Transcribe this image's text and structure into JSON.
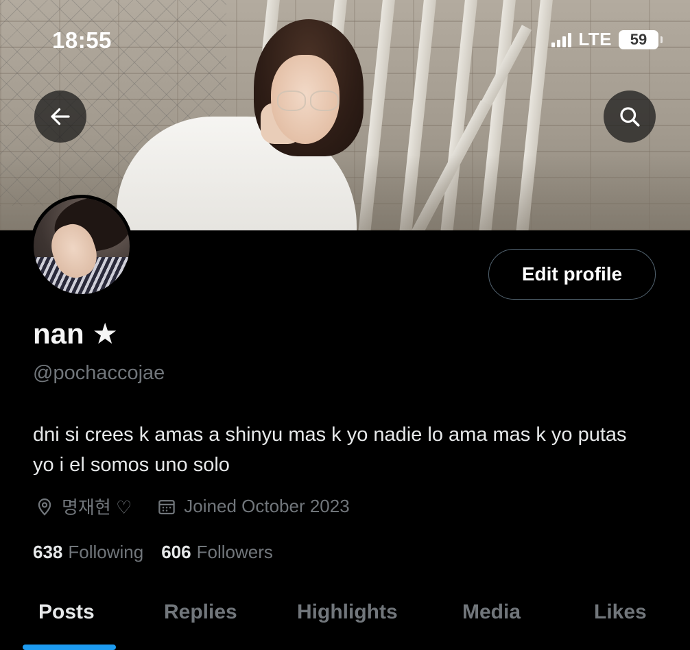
{
  "status_bar": {
    "time": "18:55",
    "network": "LTE",
    "battery": "59"
  },
  "header": {
    "back_icon": "arrow-left-icon",
    "search_icon": "search-icon"
  },
  "profile": {
    "edit_label": "Edit profile",
    "display_name": "nan ★",
    "handle": "@pochaccojae",
    "bio": "dni si crees k amas a shinyu mas k yo nadie lo ama mas k yo putas yo i el somos uno solo",
    "location": "명재현 ♡",
    "joined": "Joined October 2023",
    "following_count": "638",
    "following_label": "Following",
    "followers_count": "606",
    "followers_label": "Followers"
  },
  "tabs": [
    {
      "label": "Posts",
      "active": true
    },
    {
      "label": "Replies",
      "active": false
    },
    {
      "label": "Highlights",
      "active": false
    },
    {
      "label": "Media",
      "active": false
    },
    {
      "label": "Likes",
      "active": false
    }
  ],
  "colors": {
    "background": "#000000",
    "accent": "#1d9bf0",
    "secondary_text": "#71767b",
    "primary_text": "#e7e9ea"
  }
}
